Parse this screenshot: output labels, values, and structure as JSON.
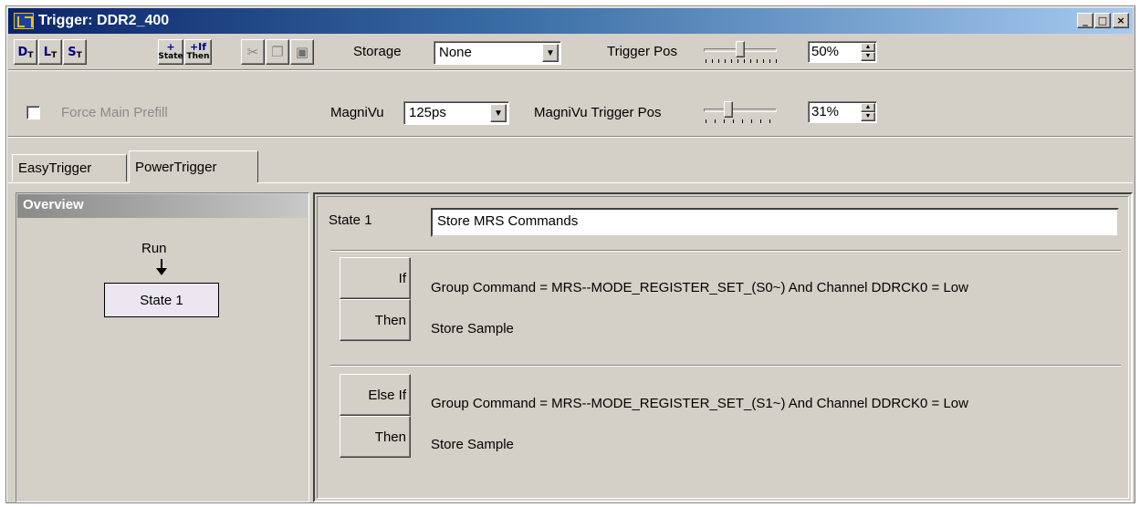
{
  "window": {
    "title": "Trigger: DDR2_400",
    "controls": {
      "minimize": "_",
      "maximize": "□",
      "close": "×"
    }
  },
  "toolbar": {
    "buttons": [
      {
        "name": "D",
        "sub": "T"
      },
      {
        "name": "L",
        "sub": "T"
      },
      {
        "name": "S",
        "sub": "T"
      },
      {
        "name": "+",
        "sub": "State"
      },
      {
        "name": "+If",
        "sub": "Then"
      }
    ],
    "edit_icons": [
      "cut-icon",
      "copy-icon",
      "paste-icon"
    ],
    "storage_label": "Storage",
    "storage_value": "None",
    "trigger_pos_label": "Trigger Pos",
    "trigger_pos_value": "50%",
    "trigger_pos_fraction": 0.5
  },
  "row2": {
    "force_main_prefill_label": "Force Main Prefill",
    "force_main_prefill_checked": false,
    "magnivu_label": "MagniVu",
    "magnivu_value": "125ps",
    "magnivu_trigger_pos_label": "MagniVu Trigger Pos",
    "magnivu_trigger_pos_value": "31%",
    "magnivu_trigger_pos_fraction": 0.31
  },
  "tabs": [
    {
      "label": "EasyTrigger",
      "active": false
    },
    {
      "label": "PowerTrigger",
      "active": true
    }
  ],
  "overview": {
    "header": "Overview",
    "run_label": "Run",
    "states": [
      "State 1"
    ]
  },
  "editor": {
    "state_label": "State 1",
    "state_name": "Store MRS Commands",
    "clauses": [
      {
        "if_label": "If",
        "condition": "Group Command = MRS--MODE_REGISTER_SET_(S0~) And Channel DDRCK0 = Low",
        "then_label": "Then",
        "action": "Store Sample"
      },
      {
        "if_label": "Else If",
        "condition": "Group Command = MRS--MODE_REGISTER_SET_(S1~) And Channel DDRCK0 = Low",
        "then_label": "Then",
        "action": "Store Sample"
      }
    ]
  },
  "colors": {
    "title_gradient_start": "#0a246a",
    "title_gradient_end": "#a6caf0",
    "face": "#d4d0c8",
    "state_box": "#ebe6f0"
  }
}
